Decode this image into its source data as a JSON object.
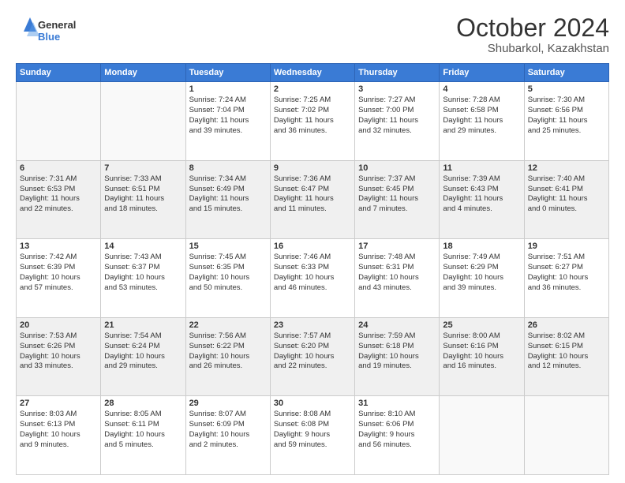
{
  "header": {
    "logo_general": "General",
    "logo_blue": "Blue",
    "month": "October 2024",
    "location": "Shubarkol, Kazakhstan"
  },
  "weekdays": [
    "Sunday",
    "Monday",
    "Tuesday",
    "Wednesday",
    "Thursday",
    "Friday",
    "Saturday"
  ],
  "rows": [
    [
      {
        "day": "",
        "lines": [],
        "empty": true
      },
      {
        "day": "",
        "lines": [],
        "empty": true
      },
      {
        "day": "1",
        "lines": [
          "Sunrise: 7:24 AM",
          "Sunset: 7:04 PM",
          "Daylight: 11 hours",
          "and 39 minutes."
        ]
      },
      {
        "day": "2",
        "lines": [
          "Sunrise: 7:25 AM",
          "Sunset: 7:02 PM",
          "Daylight: 11 hours",
          "and 36 minutes."
        ]
      },
      {
        "day": "3",
        "lines": [
          "Sunrise: 7:27 AM",
          "Sunset: 7:00 PM",
          "Daylight: 11 hours",
          "and 32 minutes."
        ]
      },
      {
        "day": "4",
        "lines": [
          "Sunrise: 7:28 AM",
          "Sunset: 6:58 PM",
          "Daylight: 11 hours",
          "and 29 minutes."
        ]
      },
      {
        "day": "5",
        "lines": [
          "Sunrise: 7:30 AM",
          "Sunset: 6:56 PM",
          "Daylight: 11 hours",
          "and 25 minutes."
        ]
      }
    ],
    [
      {
        "day": "6",
        "lines": [
          "Sunrise: 7:31 AM",
          "Sunset: 6:53 PM",
          "Daylight: 11 hours",
          "and 22 minutes."
        ],
        "shaded": true
      },
      {
        "day": "7",
        "lines": [
          "Sunrise: 7:33 AM",
          "Sunset: 6:51 PM",
          "Daylight: 11 hours",
          "and 18 minutes."
        ],
        "shaded": true
      },
      {
        "day": "8",
        "lines": [
          "Sunrise: 7:34 AM",
          "Sunset: 6:49 PM",
          "Daylight: 11 hours",
          "and 15 minutes."
        ],
        "shaded": true
      },
      {
        "day": "9",
        "lines": [
          "Sunrise: 7:36 AM",
          "Sunset: 6:47 PM",
          "Daylight: 11 hours",
          "and 11 minutes."
        ],
        "shaded": true
      },
      {
        "day": "10",
        "lines": [
          "Sunrise: 7:37 AM",
          "Sunset: 6:45 PM",
          "Daylight: 11 hours",
          "and 7 minutes."
        ],
        "shaded": true
      },
      {
        "day": "11",
        "lines": [
          "Sunrise: 7:39 AM",
          "Sunset: 6:43 PM",
          "Daylight: 11 hours",
          "and 4 minutes."
        ],
        "shaded": true
      },
      {
        "day": "12",
        "lines": [
          "Sunrise: 7:40 AM",
          "Sunset: 6:41 PM",
          "Daylight: 11 hours",
          "and 0 minutes."
        ],
        "shaded": true
      }
    ],
    [
      {
        "day": "13",
        "lines": [
          "Sunrise: 7:42 AM",
          "Sunset: 6:39 PM",
          "Daylight: 10 hours",
          "and 57 minutes."
        ]
      },
      {
        "day": "14",
        "lines": [
          "Sunrise: 7:43 AM",
          "Sunset: 6:37 PM",
          "Daylight: 10 hours",
          "and 53 minutes."
        ]
      },
      {
        "day": "15",
        "lines": [
          "Sunrise: 7:45 AM",
          "Sunset: 6:35 PM",
          "Daylight: 10 hours",
          "and 50 minutes."
        ]
      },
      {
        "day": "16",
        "lines": [
          "Sunrise: 7:46 AM",
          "Sunset: 6:33 PM",
          "Daylight: 10 hours",
          "and 46 minutes."
        ]
      },
      {
        "day": "17",
        "lines": [
          "Sunrise: 7:48 AM",
          "Sunset: 6:31 PM",
          "Daylight: 10 hours",
          "and 43 minutes."
        ]
      },
      {
        "day": "18",
        "lines": [
          "Sunrise: 7:49 AM",
          "Sunset: 6:29 PM",
          "Daylight: 10 hours",
          "and 39 minutes."
        ]
      },
      {
        "day": "19",
        "lines": [
          "Sunrise: 7:51 AM",
          "Sunset: 6:27 PM",
          "Daylight: 10 hours",
          "and 36 minutes."
        ]
      }
    ],
    [
      {
        "day": "20",
        "lines": [
          "Sunrise: 7:53 AM",
          "Sunset: 6:26 PM",
          "Daylight: 10 hours",
          "and 33 minutes."
        ],
        "shaded": true
      },
      {
        "day": "21",
        "lines": [
          "Sunrise: 7:54 AM",
          "Sunset: 6:24 PM",
          "Daylight: 10 hours",
          "and 29 minutes."
        ],
        "shaded": true
      },
      {
        "day": "22",
        "lines": [
          "Sunrise: 7:56 AM",
          "Sunset: 6:22 PM",
          "Daylight: 10 hours",
          "and 26 minutes."
        ],
        "shaded": true
      },
      {
        "day": "23",
        "lines": [
          "Sunrise: 7:57 AM",
          "Sunset: 6:20 PM",
          "Daylight: 10 hours",
          "and 22 minutes."
        ],
        "shaded": true
      },
      {
        "day": "24",
        "lines": [
          "Sunrise: 7:59 AM",
          "Sunset: 6:18 PM",
          "Daylight: 10 hours",
          "and 19 minutes."
        ],
        "shaded": true
      },
      {
        "day": "25",
        "lines": [
          "Sunrise: 8:00 AM",
          "Sunset: 6:16 PM",
          "Daylight: 10 hours",
          "and 16 minutes."
        ],
        "shaded": true
      },
      {
        "day": "26",
        "lines": [
          "Sunrise: 8:02 AM",
          "Sunset: 6:15 PM",
          "Daylight: 10 hours",
          "and 12 minutes."
        ],
        "shaded": true
      }
    ],
    [
      {
        "day": "27",
        "lines": [
          "Sunrise: 8:03 AM",
          "Sunset: 6:13 PM",
          "Daylight: 10 hours",
          "and 9 minutes."
        ]
      },
      {
        "day": "28",
        "lines": [
          "Sunrise: 8:05 AM",
          "Sunset: 6:11 PM",
          "Daylight: 10 hours",
          "and 5 minutes."
        ]
      },
      {
        "day": "29",
        "lines": [
          "Sunrise: 8:07 AM",
          "Sunset: 6:09 PM",
          "Daylight: 10 hours",
          "and 2 minutes."
        ]
      },
      {
        "day": "30",
        "lines": [
          "Sunrise: 8:08 AM",
          "Sunset: 6:08 PM",
          "Daylight: 9 hours",
          "and 59 minutes."
        ]
      },
      {
        "day": "31",
        "lines": [
          "Sunrise: 8:10 AM",
          "Sunset: 6:06 PM",
          "Daylight: 9 hours",
          "and 56 minutes."
        ]
      },
      {
        "day": "",
        "lines": [],
        "empty": true
      },
      {
        "day": "",
        "lines": [],
        "empty": true
      }
    ]
  ]
}
